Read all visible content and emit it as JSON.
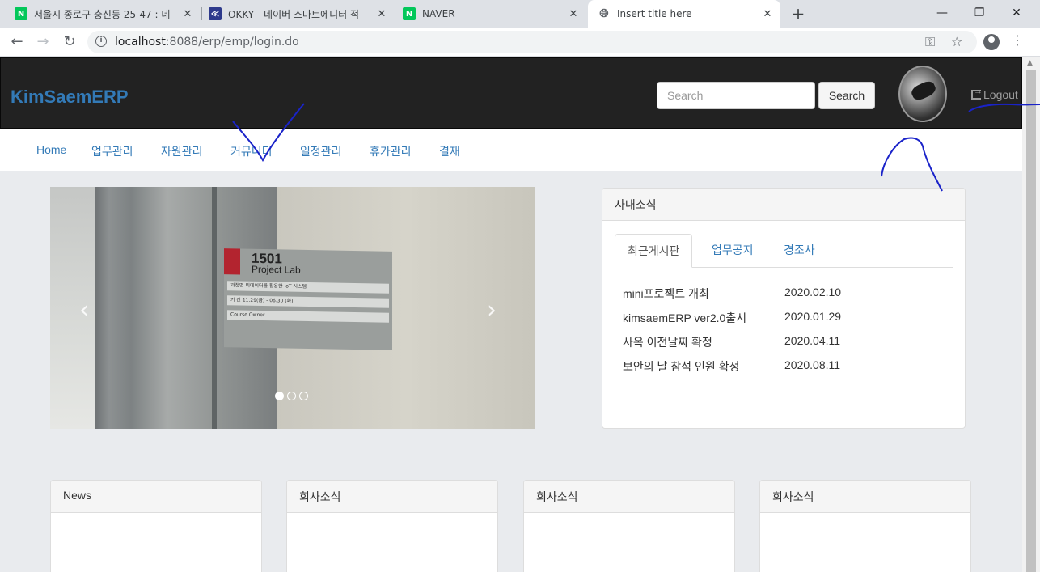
{
  "browser": {
    "tabs": [
      {
        "title": "서울시 종로구 충신동 25-47 : 네",
        "favicon": "naver-icon",
        "favicon_color": "#03c75a",
        "active": false
      },
      {
        "title": "OKKY - 네이버 스마트에디터 적",
        "favicon": "okky-icon",
        "favicon_color": "#2e3a8c",
        "active": false
      },
      {
        "title": "NAVER",
        "favicon": "naver-icon",
        "favicon_color": "#03c75a",
        "active": false
      },
      {
        "title": "Insert title here",
        "favicon": "globe-icon",
        "favicon_color": "#5f6368",
        "active": true
      }
    ],
    "url_host": "localhost",
    "url_path": ":8088/erp/emp/login.do"
  },
  "header": {
    "brand": "KimSaemERP",
    "brand_color": "#337ab7",
    "search_placeholder": "Search",
    "search_button": "Search",
    "logout": "Logout"
  },
  "nav": {
    "items": [
      "Home",
      "업무관리",
      "자원관리",
      "커뮤니티",
      "일정관리",
      "휴가관리",
      "결재"
    ]
  },
  "carousel": {
    "sign_number": "1501",
    "sign_label": "Project Lab",
    "sign_rows": [
      "과정명   빅데이터를 활용한 IoT 시스템",
      "기 간   11.29(금) - 06.30 (화)",
      "Course Owner"
    ],
    "slide_count": 3,
    "active_slide": 1
  },
  "news_panel": {
    "heading": "사내소식",
    "tabs": [
      "최근게시판",
      "업무공지",
      "경조사"
    ],
    "active_tab": 0,
    "items": [
      {
        "title": "mini프로젝트 개최",
        "date": "2020.02.10"
      },
      {
        "title": "kimsaemERP ver2.0출시",
        "date": "2020.01.29"
      },
      {
        "title": "사옥 이전날짜 확정",
        "date": "2020.04.11"
      },
      {
        "title": "보안의 날 참석 인원 확정",
        "date": "2020.08.11"
      }
    ]
  },
  "cards": [
    {
      "heading": "News"
    },
    {
      "heading": "회사소식"
    },
    {
      "heading": "회사소식"
    },
    {
      "heading": "회사소식"
    }
  ]
}
